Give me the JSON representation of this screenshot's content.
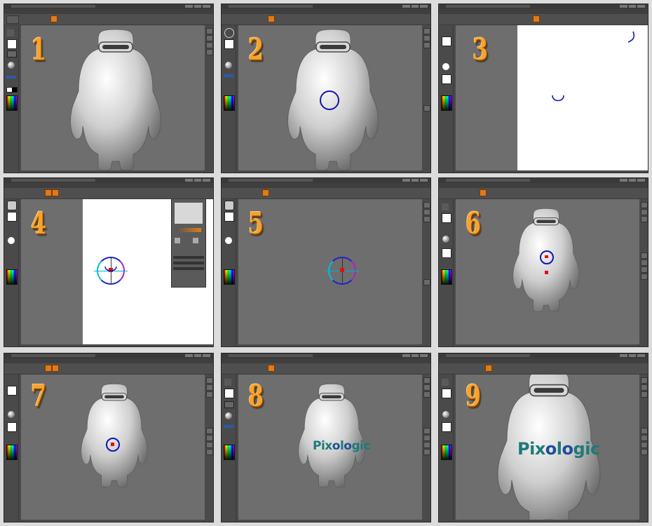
{
  "app": {
    "accent_color": "#e07a1a",
    "canvas_color": "#6e6e6e",
    "stroke_color": "#1414b4",
    "marker_color": "#e01010",
    "logo_colors": {
      "text": "#1f7a7a",
      "o_letters": "#1f4f9a"
    }
  },
  "steps": [
    {
      "number": "1",
      "content": "figure"
    },
    {
      "number": "2",
      "content": "figure-with-circle"
    },
    {
      "number": "3",
      "content": "white-document-with-strokes"
    },
    {
      "number": "4",
      "content": "white-document-with-gizmo-and-panel"
    },
    {
      "number": "5",
      "content": "gray-canvas-with-gizmo"
    },
    {
      "number": "6",
      "content": "small-figure-with-circle-and-markers"
    },
    {
      "number": "7",
      "content": "figure-with-circle-and-marker"
    },
    {
      "number": "8",
      "content": "figure-with-logo"
    },
    {
      "number": "9",
      "content": "large-figure-with-logo"
    }
  ],
  "logo": {
    "part1": "Pix",
    "o1": "o",
    "part2": "l",
    "o2": "o",
    "part3": "gic"
  },
  "icons": {
    "left_tray": [
      "brush-icon",
      "material-sphere-icon",
      "color-palette-icon"
    ],
    "right_tray": [
      "view-control-icon"
    ]
  }
}
